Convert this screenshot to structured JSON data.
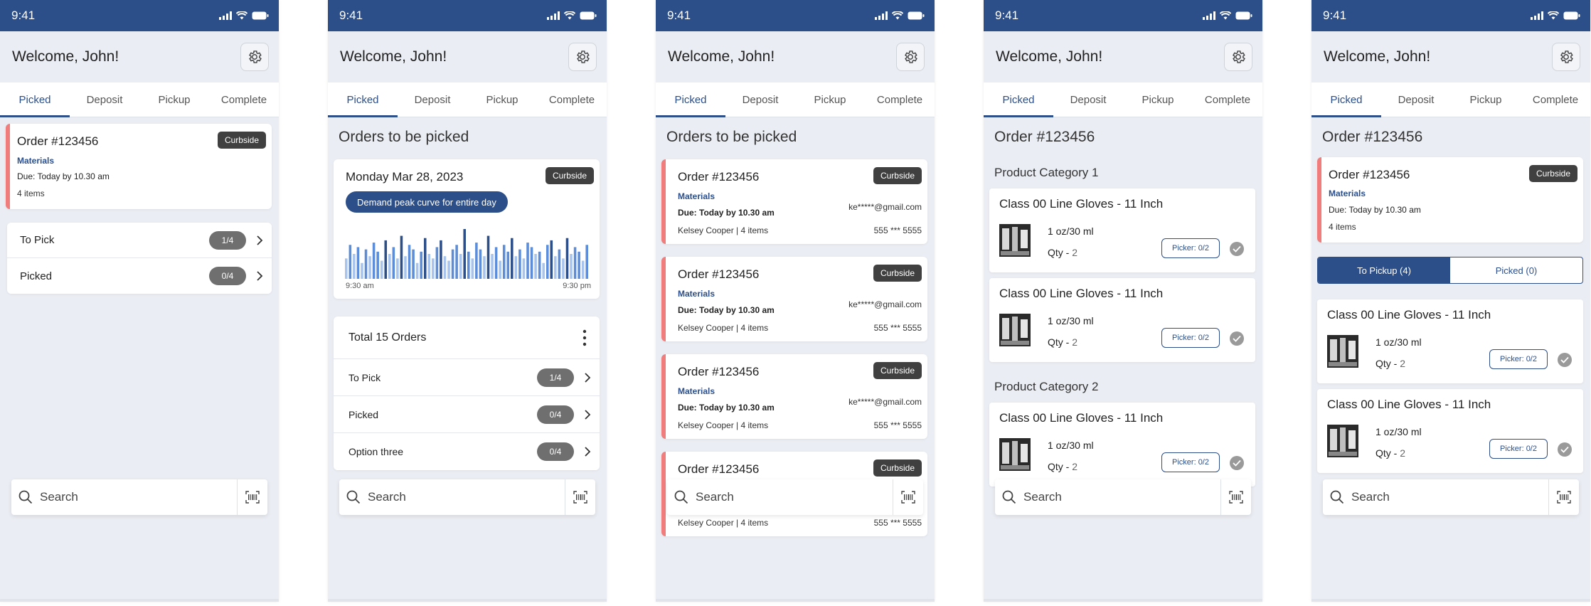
{
  "status": {
    "time": "9:41"
  },
  "header": {
    "welcome": "Welcome, John!"
  },
  "tabs": [
    "Picked",
    "Deposit",
    "Pickup",
    "Complete"
  ],
  "search": {
    "placeholder": "Search"
  },
  "order": {
    "title": "Order #123456",
    "badge": "Curbside",
    "materials": "Materials",
    "due": "Due: Today by 10.30 am",
    "items": "4 items",
    "email": "ke*****@gmail.com",
    "customer": "Kelsey Cooper | 4 items",
    "phone": "555 *** 5555"
  },
  "screen1": {
    "rows": [
      {
        "label": "To Pick",
        "count": "1/4"
      },
      {
        "label": "Picked",
        "count": "0/4"
      }
    ]
  },
  "screen2": {
    "section_title": "Orders to be picked",
    "date": "Monday Mar 28, 2023",
    "badge": "Curbside",
    "chart_button": "Demand peak curve for entire day",
    "time_start": "9:30 am",
    "time_end": "9:30 pm",
    "total_orders": "Total 15 Orders",
    "rows": [
      {
        "label": "To Pick",
        "count": "1/4"
      },
      {
        "label": "Picked",
        "count": "0/4"
      },
      {
        "label": "Option three",
        "count": "0/4"
      }
    ]
  },
  "chart_data": {
    "type": "bar",
    "title": "Demand peak curve for entire day",
    "x_start": "9:30 am",
    "x_end": "9:30 pm",
    "values": [
      18,
      30,
      22,
      28,
      14,
      26,
      20,
      32,
      24,
      16,
      34,
      22,
      28,
      18,
      38,
      20,
      30,
      26,
      14,
      24,
      36,
      22,
      18,
      28,
      34,
      20,
      16,
      26,
      30,
      22,
      44,
      24,
      18,
      32,
      26,
      20,
      38,
      22,
      28,
      16,
      30,
      24,
      36,
      20,
      26,
      18,
      32,
      28,
      22,
      24,
      14,
      30,
      34,
      20,
      26,
      18,
      36,
      22,
      28,
      24,
      16,
      30
    ],
    "colors": [
      "#a6c4ee",
      "#5b8dd8",
      "#2c4f8a"
    ]
  },
  "screen3": {
    "section_title": "Orders to be picked"
  },
  "screen4": {
    "title": "Order #123456",
    "categories": [
      {
        "name": "Product Category 1",
        "products": [
          {
            "name": "Class 00 Line Gloves - 11 Inch",
            "volume": "1 oz/30 ml",
            "qty_label": "Qty - ",
            "qty": "2",
            "picker": "Picker: 0/2"
          },
          {
            "name": "Class 00 Line Gloves - 11 Inch",
            "volume": "1 oz/30 ml",
            "qty_label": "Qty - ",
            "qty": "2",
            "picker": "Picker: 0/2"
          }
        ]
      },
      {
        "name": "Product Category 2",
        "products": [
          {
            "name": "Class 00 Line Gloves - 11 Inch",
            "volume": "1 oz/30 ml",
            "qty_label": "Qty - ",
            "qty": "2",
            "picker": "Picker: 0/2"
          }
        ]
      }
    ]
  },
  "screen5": {
    "title": "Order #123456",
    "segments": [
      "To Pickup (4)",
      "Picked (0)"
    ],
    "products": [
      {
        "name": "Class 00 Line Gloves - 11 Inch",
        "volume": "1 oz/30 ml",
        "qty_label": "Qty - ",
        "qty": "2",
        "picker": "Picker: 0/2"
      },
      {
        "name": "Class 00 Line Gloves - 11 Inch",
        "volume": "1 oz/30 ml",
        "qty_label": "Qty - ",
        "qty": "2",
        "picker": "Picker: 0/2"
      }
    ]
  }
}
